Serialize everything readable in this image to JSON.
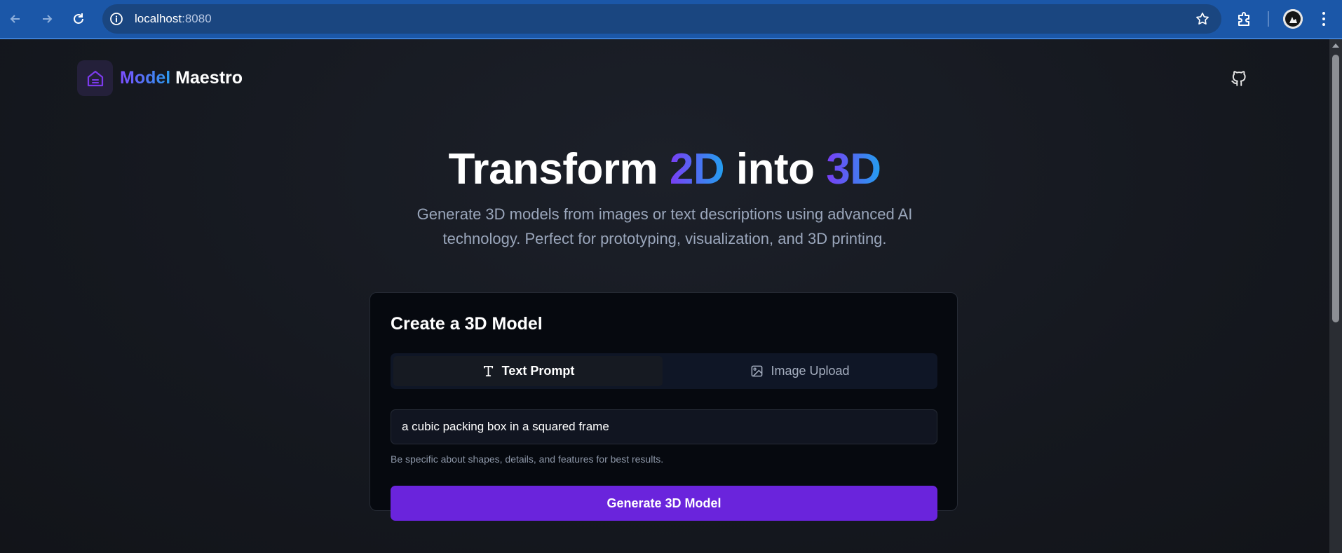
{
  "browser": {
    "url_host": "localhost",
    "url_port": ":8080",
    "back_icon": "arrow-left-icon",
    "forward_icon": "arrow-right-icon",
    "reload_icon": "reload-icon",
    "site_info_icon": "info-icon",
    "bookmark_icon": "star-icon",
    "extensions_icon": "puzzle-icon",
    "menu_icon": "kebab-menu-icon"
  },
  "header": {
    "brand_part1": "Model",
    "brand_part2": " Maestro",
    "logo_icon": "home-icon",
    "github_icon": "github-icon"
  },
  "hero": {
    "title_part1": "Transform ",
    "title_highlight1": "2D",
    "title_part2": " into ",
    "title_highlight2": "3D",
    "subtitle": "Generate 3D models from images or text descriptions using advanced AI technology. Perfect for prototyping, visualization, and 3D printing."
  },
  "card": {
    "title": "Create a 3D Model",
    "tabs": [
      {
        "label": "Text Prompt",
        "icon": "text-icon",
        "active": true
      },
      {
        "label": "Image Upload",
        "icon": "image-icon",
        "active": false
      }
    ],
    "prompt_value": "a cubic packing box in a squared frame",
    "hint": "Be specific about shapes, details, and features for best results.",
    "generate_label": "Generate 3D Model"
  },
  "colors": {
    "accent_purple": "#6a24dc",
    "gradient_start": "#7a3df5",
    "gradient_end": "#22a0ef",
    "browser_bar": "#1b57a8"
  }
}
